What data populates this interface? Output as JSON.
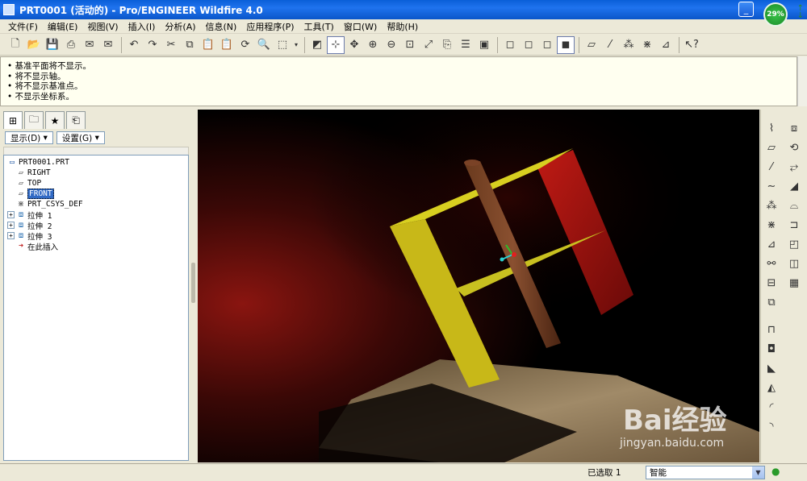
{
  "window": {
    "title": "PRT0001 (活动的) - Pro/ENGINEER Wildfire 4.0",
    "cpu_badge": "29%"
  },
  "menu": [
    "文件(F)",
    "编辑(E)",
    "视图(V)",
    "插入(I)",
    "分析(A)",
    "信息(N)",
    "应用程序(P)",
    "工具(T)",
    "窗口(W)",
    "帮助(H)"
  ],
  "messages": [
    "基准平面将不显示。",
    "将不显示轴。",
    "将不显示基准点。",
    "不显示坐标系。"
  ],
  "model_tree": {
    "show_button": "显示(D)",
    "settings_button": "设置(G)",
    "root": "PRT0001.PRT",
    "items": [
      {
        "label": "RIGHT",
        "icon": "datum-plane-icon",
        "expandable": false,
        "selected": false
      },
      {
        "label": "TOP",
        "icon": "datum-plane-icon",
        "expandable": false,
        "selected": false
      },
      {
        "label": "FRONT",
        "icon": "datum-plane-icon",
        "expandable": false,
        "selected": true
      },
      {
        "label": "PRT_CSYS_DEF",
        "icon": "csys-icon",
        "expandable": false,
        "selected": false
      },
      {
        "label": "拉伸 1",
        "icon": "extrude-icon",
        "expandable": true,
        "selected": false
      },
      {
        "label": "拉伸 2",
        "icon": "extrude-icon",
        "expandable": true,
        "selected": false
      },
      {
        "label": "拉伸 3",
        "icon": "extrude-icon",
        "expandable": true,
        "selected": false
      },
      {
        "label": "在此插入",
        "icon": "insert-here-arrow-icon",
        "expandable": false,
        "selected": false
      }
    ]
  },
  "status": {
    "selected": "已选取 1",
    "filter": "智能"
  },
  "watermark": {
    "brand": "Bai经验",
    "url": "jingyan.baidu.com"
  },
  "colors": {
    "accent": "#316ac5",
    "titlebar": "#0a5fd8",
    "part_yellow": "#c8c020",
    "part_red": "#a01818",
    "part_brown": "#5a2a1a"
  }
}
